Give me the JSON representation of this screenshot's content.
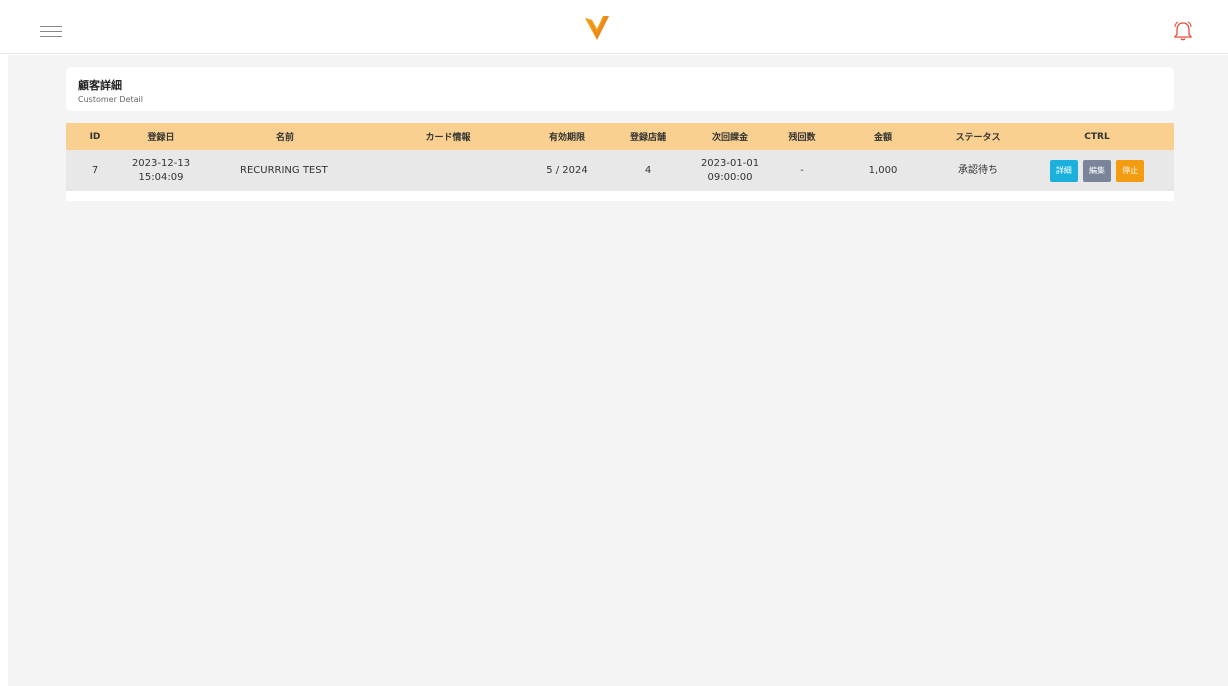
{
  "header": {
    "menu_icon": "hamburger-menu-icon",
    "logo_icon": "brand-logo",
    "bell_icon": "bell-icon",
    "colors": {
      "logo": "#f39c12",
      "bell": "#e74c3c"
    }
  },
  "page": {
    "title": "顧客詳細",
    "subtitle": "Customer Detail"
  },
  "table": {
    "headers": {
      "id": "ID",
      "registered": "登録日",
      "name": "名前",
      "card": "カード情報",
      "expiry": "有効期限",
      "store": "登録店舗",
      "next_charge": "次回課金",
      "remaining": "残回数",
      "amount": "金額",
      "status": "ステータス",
      "ctrl": "CTRL"
    },
    "rows": [
      {
        "id": "7",
        "registered_date": "2023-12-13",
        "registered_time": "15:04:09",
        "name": "RECURRING TEST",
        "card": "",
        "expiry": "5 / 2024",
        "store": "4",
        "next_charge_date": "2023-01-01",
        "next_charge_time": "09:00:00",
        "remaining": "-",
        "amount": "1,000",
        "status": "承認待ち",
        "buttons": {
          "detail": "詳細",
          "edit": "編集",
          "stop": "停止"
        }
      }
    ]
  }
}
